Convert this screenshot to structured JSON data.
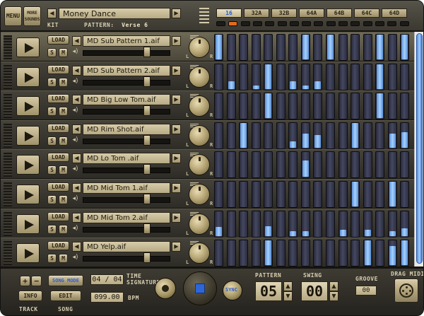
{
  "header": {
    "menu_label": "MENU",
    "more_sounds_label": "MORE SOUNDS",
    "kit_label": "KIT",
    "kit_name": "Money Dance",
    "pattern_label": "PATTERN:",
    "pattern_name": "Verse 6",
    "tabs": [
      "16",
      "32A",
      "32B",
      "64A",
      "64B",
      "64C",
      "64D"
    ],
    "active_tab": "16"
  },
  "track_labels": {
    "load": "LOAD",
    "solo": "S",
    "mute": "M",
    "left": "L",
    "right": "R"
  },
  "tracks": [
    {
      "sample": "MD Sub Pattern 1.aif",
      "volume": 0.75,
      "steps": [
        1,
        0,
        0,
        0,
        0,
        0,
        0,
        1,
        0,
        1,
        0,
        0,
        0,
        1,
        0,
        1
      ],
      "levels": [
        1,
        0,
        0,
        0,
        0,
        0,
        0,
        1,
        0,
        1,
        0,
        0,
        0,
        1,
        0,
        1
      ]
    },
    {
      "sample": "MD Sub Pattern 2.aif",
      "volume": 0.75,
      "steps": [
        0,
        1,
        0,
        1,
        1,
        0,
        1,
        1,
        1,
        0,
        0,
        0,
        0,
        1,
        0,
        0
      ],
      "levels": [
        0,
        0.3,
        0,
        0.15,
        1,
        0,
        0.3,
        0.15,
        0.3,
        0,
        0,
        0,
        0,
        1,
        0,
        0
      ]
    },
    {
      "sample": "MD Big Low Tom.aif",
      "volume": 0.75,
      "steps": [
        0,
        0,
        0,
        0,
        1,
        0,
        0,
        0,
        0,
        0,
        0,
        0,
        0,
        1,
        0,
        0
      ],
      "levels": [
        0,
        0,
        0,
        0,
        1,
        0,
        0,
        0,
        0,
        0,
        0,
        0,
        0,
        1,
        0,
        0
      ]
    },
    {
      "sample": "MD Rim Shot.aif",
      "volume": 0.75,
      "steps": [
        0,
        0,
        1,
        0,
        0,
        0,
        1,
        1,
        1,
        0,
        0,
        1,
        0,
        0,
        1,
        1
      ],
      "levels": [
        0,
        0,
        1,
        0,
        0,
        0,
        0.25,
        0.55,
        0.5,
        0,
        0,
        1,
        0,
        0,
        0.55,
        0.6
      ]
    },
    {
      "sample": "MD Lo Tom .aif",
      "volume": 0.75,
      "steps": [
        0,
        0,
        0,
        0,
        0,
        0,
        0,
        1,
        0,
        0,
        0,
        0,
        0,
        0,
        0,
        0
      ],
      "levels": [
        0,
        0,
        0,
        0,
        0,
        0,
        0,
        0.65,
        0,
        0,
        0,
        0,
        0,
        0,
        0,
        0
      ]
    },
    {
      "sample": "MD Mid Tom 1.aif",
      "volume": 0.75,
      "steps": [
        0,
        0,
        0,
        0,
        0,
        0,
        0,
        0,
        0,
        0,
        0,
        1,
        0,
        0,
        1,
        0
      ],
      "levels": [
        0,
        0,
        0,
        0,
        0,
        0,
        0,
        0,
        0,
        0,
        0,
        1,
        0,
        0,
        1,
        0
      ]
    },
    {
      "sample": "MD Mid Tom 2.aif",
      "volume": 0.75,
      "steps": [
        1,
        0,
        0,
        0,
        1,
        0,
        1,
        1,
        0,
        0,
        1,
        0,
        1,
        0,
        1,
        1
      ],
      "levels": [
        0.35,
        0,
        0,
        0,
        0.4,
        0,
        0.2,
        0.2,
        0,
        0,
        0.25,
        0,
        0.25,
        0,
        0.2,
        0.3
      ]
    },
    {
      "sample": "MD Yelp.aif",
      "volume": 0.75,
      "steps": [
        0,
        0,
        0,
        0,
        1,
        0,
        0,
        0,
        0,
        0,
        0,
        0,
        1,
        0,
        1,
        1
      ],
      "levels": [
        0,
        0,
        0,
        0,
        1,
        0,
        0,
        0,
        0,
        0,
        0,
        0,
        1,
        0,
        0.75,
        1
      ]
    }
  ],
  "bottom": {
    "plus": "+",
    "minus": "−",
    "track_label": "TRACK",
    "info_label": "INFO",
    "song_mode_label": "SONG MODE",
    "edit_label": "EDIT",
    "song_label": "SONG",
    "time_signature_value": "04 / 04",
    "time_signature_label": "TIME SIGNATURE",
    "bpm_value": "099.00",
    "bpm_label": "BPM",
    "sync_label": "SYNC",
    "pattern_label": "PATTERN",
    "pattern_value": "05",
    "swing_label": "SWING",
    "swing_value": "00",
    "groove_label": "GROOVE",
    "groove_value": "00",
    "drag_midi_label": "DRAG MIDI"
  },
  "colors": {
    "step_on": "#a6d2ff",
    "step_off": "#3a3d52",
    "gold": "#c9bc98",
    "active_led": "#e36a1c"
  }
}
